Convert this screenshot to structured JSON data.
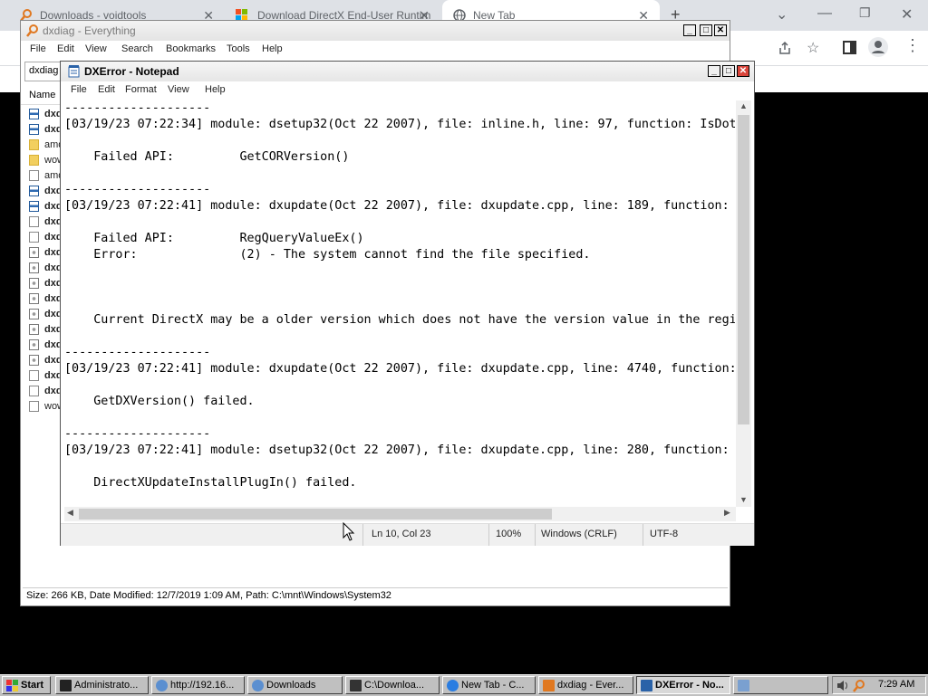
{
  "browser": {
    "tabs": [
      {
        "title": "Downloads - voidtools",
        "icon": "search-magnifier-icon"
      },
      {
        "title": "Download DirectX End-User Runtim",
        "icon": "windows-logo-icon"
      },
      {
        "title": "New Tab",
        "icon": "globe-icon"
      }
    ],
    "new_tab": "+",
    "colors": {
      "tabstrip": "#dee1e6"
    }
  },
  "everything": {
    "title": "dxdiag - Everything",
    "menu": [
      "File",
      "Edit",
      "View",
      "Search",
      "Bookmarks",
      "Tools",
      "Help"
    ],
    "search_value": "dxdiag",
    "column_name": "Name",
    "files": [
      {
        "name": "dxd",
        "icon": "app",
        "bold": true
      },
      {
        "name": "dxd",
        "icon": "app",
        "bold": true
      },
      {
        "name": "amd",
        "icon": "folder",
        "bold": false
      },
      {
        "name": "wow",
        "icon": "folder",
        "bold": false
      },
      {
        "name": "amd",
        "icon": "file",
        "bold": false
      },
      {
        "name": "dxd",
        "icon": "app",
        "bold": true
      },
      {
        "name": "dxd",
        "icon": "app",
        "bold": true
      },
      {
        "name": "dxd",
        "icon": "file",
        "bold": true
      },
      {
        "name": "dxd",
        "icon": "file",
        "bold": true
      },
      {
        "name": "dxd",
        "icon": "cfg",
        "bold": true
      },
      {
        "name": "dxd",
        "icon": "cfg",
        "bold": true
      },
      {
        "name": "dxd",
        "icon": "cfg",
        "bold": true
      },
      {
        "name": "dxd",
        "icon": "cfg",
        "bold": true
      },
      {
        "name": "dxd",
        "icon": "cfg",
        "bold": true
      },
      {
        "name": "dxd",
        "icon": "cfg",
        "bold": true
      },
      {
        "name": "dxd",
        "icon": "cfg",
        "bold": true
      },
      {
        "name": "dxd",
        "icon": "cfg",
        "bold": true
      },
      {
        "name": "dxd",
        "icon": "file",
        "bold": true
      },
      {
        "name": "dxd",
        "icon": "file",
        "bold": true
      },
      {
        "name": "wow",
        "icon": "file",
        "bold": false
      }
    ],
    "status": "Size: 266 KB, Date Modified: 12/7/2019 1:09 AM, Path: C:\\mnt\\Windows\\System32"
  },
  "notepad": {
    "title": "DXError - Notepad",
    "menu": [
      "File",
      "Edit",
      "Format",
      "View",
      "Help"
    ],
    "lines": [
      "--------------------",
      "[03/19/23 07:22:34] module: dsetup32(Oct 22 2007), file: inline.h, line: 97, function: IsDot",
      "",
      "    Failed API:         GetCORVersion()",
      "",
      "--------------------",
      "[03/19/23 07:22:41] module: dxupdate(Oct 22 2007), file: dxupdate.cpp, line: 189, function: (",
      "",
      "    Failed API:         RegQueryValueEx()",
      "    Error:              (2) - The system cannot find the file specified.",
      "",
      "",
      "",
      "    Current DirectX may be a older version which does not have the version value in the regi",
      "",
      "--------------------",
      "[03/19/23 07:22:41] module: dxupdate(Oct 22 2007), file: dxupdate.cpp, line: 4740, function:",
      "",
      "    GetDXVersion() failed.",
      "",
      "--------------------",
      "[03/19/23 07:22:41] module: dsetup32(Oct 22 2007), file: dxupdate.cpp, line: 280, function: (",
      "",
      "    DirectXUpdateInstallPlugIn() failed."
    ],
    "status": {
      "position": "Ln 10, Col 23",
      "zoom": "100%",
      "line_ending": "Windows (CRLF)",
      "encoding": "UTF-8"
    }
  },
  "taskbar": {
    "start": "Start",
    "items": [
      {
        "label": "Administrato...",
        "icon": "console-icon",
        "pressed": false
      },
      {
        "label": "http://192.16...",
        "icon": "browser-icon",
        "pressed": false
      },
      {
        "label": "Downloads",
        "icon": "browser-icon",
        "pressed": false
      },
      {
        "label": "C:\\Downloa...",
        "icon": "7zip-icon",
        "pressed": false
      },
      {
        "label": "New Tab - C...",
        "icon": "chrome-icon",
        "pressed": false
      },
      {
        "label": "dxdiag - Ever...",
        "icon": "search-magnifier-icon",
        "pressed": false
      },
      {
        "label": "DXError - No...",
        "icon": "notepad-icon",
        "pressed": true
      },
      {
        "label": "",
        "icon": "blank-window-icon",
        "pressed": false
      }
    ],
    "clock": "7:29 AM"
  }
}
